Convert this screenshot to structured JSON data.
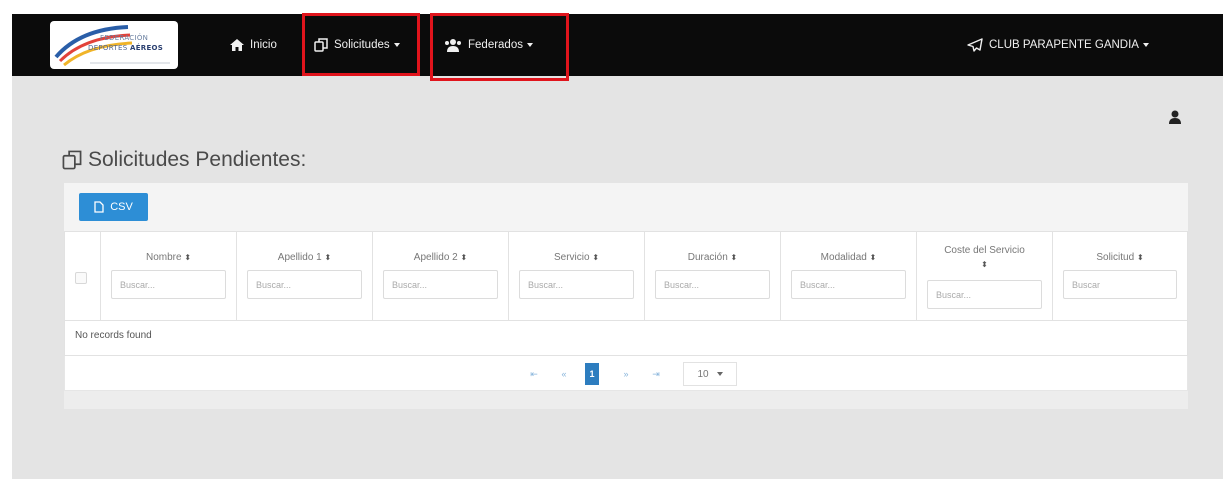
{
  "logo": {
    "line1": "FEDERACIÓN",
    "line2a": "DEPORTES",
    "line2b": "AÉREOS"
  },
  "nav": {
    "inicio": "Inicio",
    "solicitudes": "Solicitudes",
    "federados": "Federados",
    "club": "CLUB PARAPENTE GANDIA"
  },
  "page": {
    "title": "Solicitudes Pendientes:"
  },
  "toolbar": {
    "csv_label": "CSV"
  },
  "table": {
    "columns": [
      {
        "label": "Nombre",
        "placeholder": "Buscar..."
      },
      {
        "label": "Apellido 1",
        "placeholder": "Buscar..."
      },
      {
        "label": "Apellido 2",
        "placeholder": "Buscar..."
      },
      {
        "label": "Servicio",
        "placeholder": "Buscar..."
      },
      {
        "label": "Duración",
        "placeholder": "Buscar..."
      },
      {
        "label": "Modalidad",
        "placeholder": "Buscar..."
      },
      {
        "label": "Coste del Servicio",
        "placeholder": "Buscar..."
      },
      {
        "label": "Solicitud",
        "placeholder": "Buscar"
      }
    ],
    "empty_text": "No records found"
  },
  "pagination": {
    "first": "⇤",
    "prev": "«",
    "current": "1",
    "next": "»",
    "last": "⇥",
    "page_size": "10"
  },
  "colors": {
    "navbar": "#0b0b0b",
    "accent": "#2d8ed6",
    "highlight": "#e0141c",
    "background": "#e4e4e4"
  }
}
